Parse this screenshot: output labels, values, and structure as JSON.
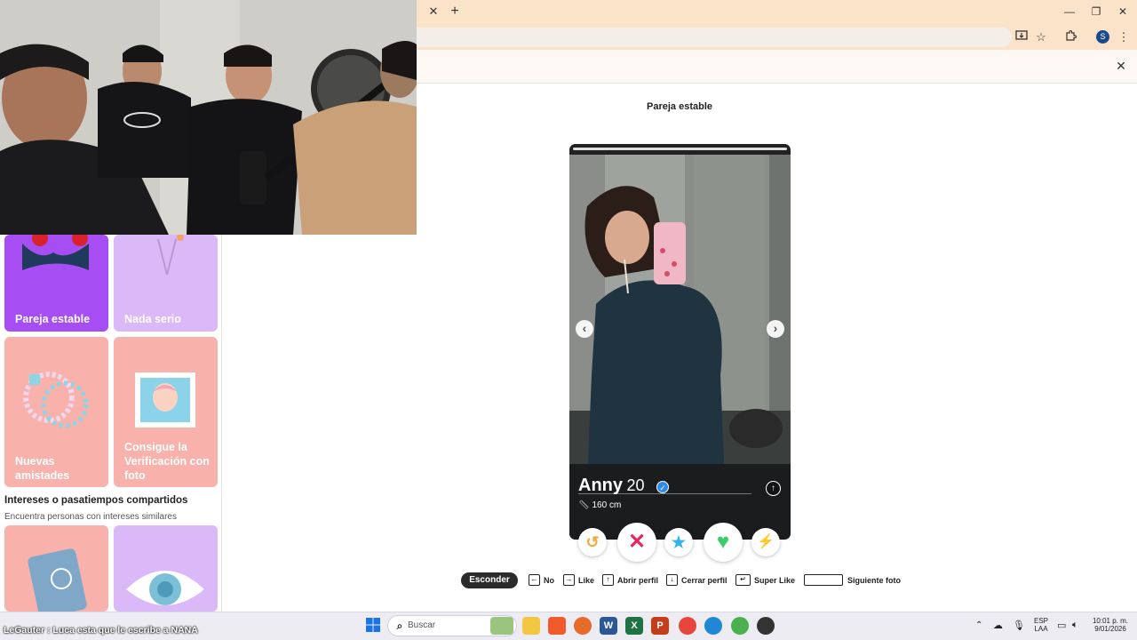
{
  "browser": {
    "tab_close": "✕",
    "new_tab": "+",
    "minimize": "—",
    "restore": "❐",
    "close": "✕",
    "profile_initial": "S",
    "infobar_close": "✕"
  },
  "sidebar": {
    "cards": [
      {
        "label": "Pareja estable",
        "color": "#a64df4"
      },
      {
        "label": "Nada serio",
        "color": "#dbb8f7"
      },
      {
        "label": "Nuevas amistades",
        "color": "#f8b1ab"
      },
      {
        "label": "Consigue la Verificación con foto",
        "color": "#f8b1ab"
      }
    ],
    "section_title": "Intereses o pasatiempos compartidos",
    "section_subtitle": "Encuentra personas con intereses similares"
  },
  "main": {
    "page_title": "Pareja estable",
    "profile": {
      "name": "Anny",
      "age": "20",
      "height": "160 cm"
    },
    "actions": [
      {
        "name": "rewind",
        "glyph": "↺",
        "color": "#f2a93b"
      },
      {
        "name": "nope",
        "glyph": "✕",
        "color": "#e8285c"
      },
      {
        "name": "super-like",
        "glyph": "★",
        "color": "#2fb3e8"
      },
      {
        "name": "like",
        "glyph": "♥",
        "color": "#3dcc6a"
      },
      {
        "name": "boost",
        "glyph": "⚡",
        "color": "#b63fe0"
      }
    ]
  },
  "shortcuts": {
    "hide": "Esconder",
    "no": "No",
    "like": "Like",
    "open_profile": "Abrir perfil",
    "close_profile": "Cerrar perfil",
    "super_like": "Super Like",
    "next_photo": "Siguiente foto"
  },
  "taskbar": {
    "search_placeholder": "Buscar",
    "lang_top": "ESP",
    "lang_bottom": "LAA",
    "time": "10:01 p. m.",
    "date": "9/01/2026"
  },
  "stream_caption": "LeGauter : Luca esta que le escribe a NANA"
}
